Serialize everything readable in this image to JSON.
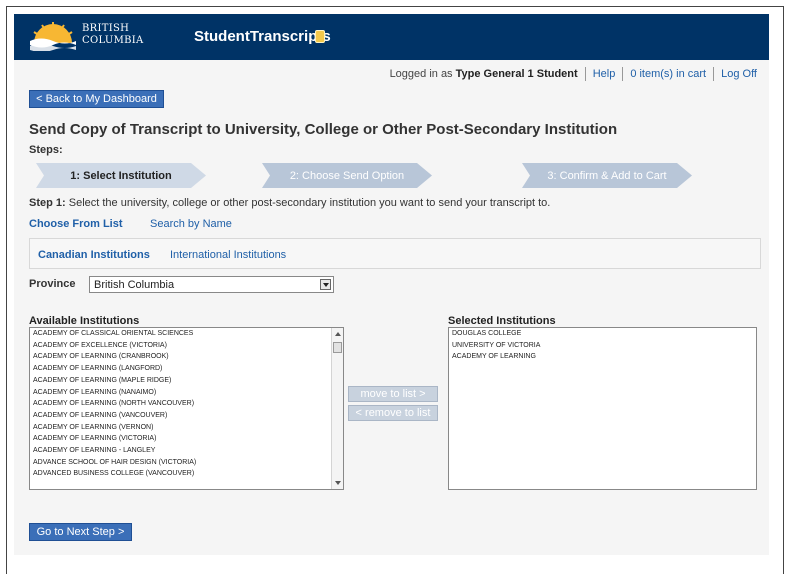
{
  "header": {
    "logo_line1": "BRITISH",
    "logo_line2": "COLUMBIA",
    "app_title": "StudentTranscripts"
  },
  "topbar": {
    "logged_in_prefix": "Logged in as",
    "user_name": "Type General 1 Student",
    "help": "Help",
    "cart": "0 item(s) in cart",
    "logoff": "Log Off"
  },
  "back_button": "< Back to My Dashboard",
  "page_title": "Send Copy of Transcript to University, College or Other Post-Secondary Institution",
  "steps_label": "Steps:",
  "steps": [
    {
      "label": "1: Select Institution",
      "state": "active"
    },
    {
      "label": "2: Choose Send Option",
      "state": "inactive"
    },
    {
      "label": "3: Confirm & Add to Cart",
      "state": "inactive"
    }
  ],
  "step_instruction": {
    "prefix": "Step 1:",
    "text": " Select the university, college or other post-secondary institution you want to send your transcript to."
  },
  "view_tabs": {
    "choose_from_list": "Choose From List",
    "search_by_name": "Search by Name"
  },
  "institution_tabs": {
    "canadian": "Canadian Institutions",
    "international": "International Institutions"
  },
  "province": {
    "label": "Province",
    "selected": "British Columbia"
  },
  "available": {
    "label": "Available Institutions",
    "items": [
      "ACADEMY OF CLASSICAL ORIENTAL SCIENCES",
      "ACADEMY OF EXCELLENCE (VICTORIA)",
      "ACADEMY OF LEARNING (CRANBROOK)",
      "ACADEMY OF LEARNING (LANGFORD)",
      "ACADEMY OF LEARNING (MAPLE RIDGE)",
      "ACADEMY OF LEARNING (NANAIMO)",
      "ACADEMY OF LEARNING (NORTH VANCOUVER)",
      "ACADEMY OF LEARNING (VANCOUVER)",
      "ACADEMY OF LEARNING (VERNON)",
      "ACADEMY OF LEARNING (VICTORIA)",
      "ACADEMY OF LEARNING - LANGLEY",
      "ADVANCE SCHOOL OF HAIR DESIGN (VICTORIA)",
      "ADVANCED BUSINESS COLLEGE (VANCOUVER)"
    ]
  },
  "move_buttons": {
    "move_to": "move to list >",
    "remove": "< remove to list"
  },
  "selected": {
    "label": "Selected Institutions",
    "items": [
      "DOUGLAS COLLEGE",
      "UNIVERSITY OF VICTORIA",
      "ACADEMY OF LEARNING"
    ]
  },
  "next_button": "Go to Next Step >",
  "colors": {
    "header_bg": "#003366",
    "link": "#2060a8",
    "button": "#3b6fb8",
    "step_active": "#cfd9e6",
    "step_inactive": "#b8c6d8"
  }
}
